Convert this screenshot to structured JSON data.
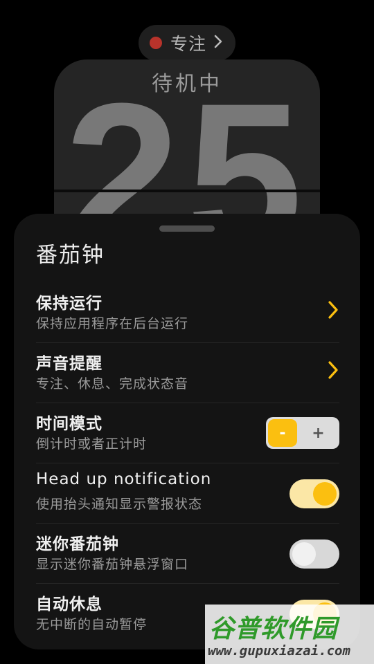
{
  "focus_pill": {
    "label": "专注",
    "dot_color": "#b8332b",
    "icon": "chevron-right-icon"
  },
  "clock": {
    "status": "待机中",
    "minutes": "25"
  },
  "sheet": {
    "title": "番茄钟",
    "rows": [
      {
        "title": "保持运行",
        "subtitle": "保持应用程序在后台运行",
        "control": "chevron"
      },
      {
        "title": "声音提醒",
        "subtitle": "专注、休息、完成状态音",
        "control": "chevron"
      },
      {
        "title": "时间模式",
        "subtitle": "倒计时或者正计时",
        "control": "stepper",
        "minus_label": "-",
        "plus_label": "+",
        "selected": "-"
      },
      {
        "title": "Head up notification",
        "subtitle": "使用抬头通知显示警报状态",
        "control": "toggle",
        "on": true
      },
      {
        "title": "迷你番茄钟",
        "subtitle": "显示迷你番茄钟悬浮窗口",
        "control": "toggle",
        "on": false
      },
      {
        "title": "自动休息",
        "subtitle": "无中断的自动暂停",
        "control": "toggle",
        "on": true
      }
    ]
  },
  "colors": {
    "accent": "#fbbf10",
    "accent_light": "#fbe7a6",
    "sheet_bg": "#141414",
    "page_bg": "#000000"
  },
  "watermark": {
    "logo": "谷普软件园",
    "url": "www.gupuxiazai.com"
  }
}
